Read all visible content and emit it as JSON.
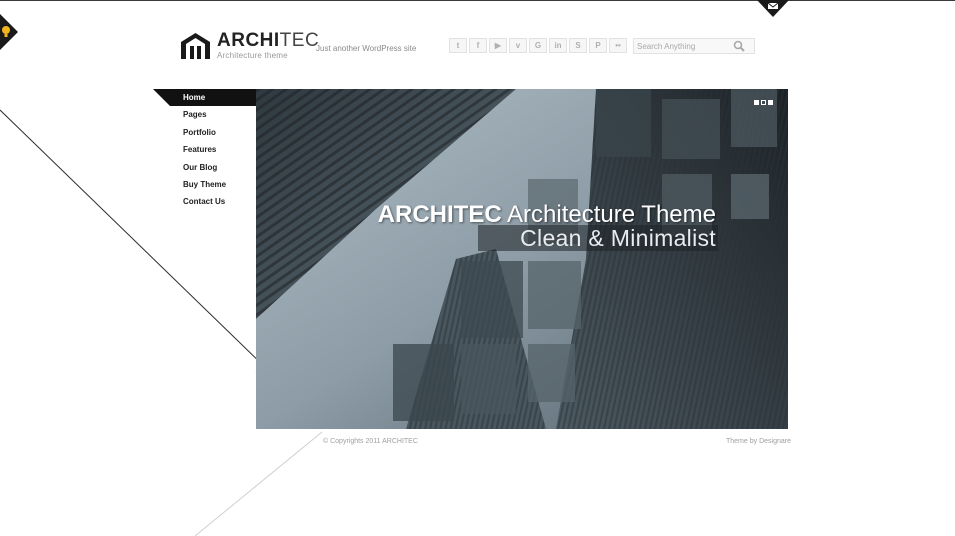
{
  "logo": {
    "title_bold": "ARCHI",
    "title_light": "TEC",
    "subtitle": "Architecture theme"
  },
  "tagline": "Just another WordPress site",
  "social": {
    "items": [
      {
        "icon": "twitter-icon",
        "glyph": "t"
      },
      {
        "icon": "facebook-icon",
        "glyph": "f"
      },
      {
        "icon": "youtube-icon",
        "glyph": "▶"
      },
      {
        "icon": "vimeo-icon",
        "glyph": "v"
      },
      {
        "icon": "google-icon",
        "glyph": "G"
      },
      {
        "icon": "linkedin-icon",
        "glyph": "in"
      },
      {
        "icon": "skype-icon",
        "glyph": "S"
      },
      {
        "icon": "pinterest-icon",
        "glyph": "P"
      },
      {
        "icon": "flickr-icon",
        "glyph": "••"
      }
    ]
  },
  "search": {
    "placeholder": "Search Anything"
  },
  "nav": {
    "items": [
      {
        "label": "Home"
      },
      {
        "label": "Pages"
      },
      {
        "label": "Portfolio"
      },
      {
        "label": "Features"
      },
      {
        "label": "Our Blog"
      },
      {
        "label": "Buy Theme"
      },
      {
        "label": "Contact Us"
      }
    ],
    "active_index": 0
  },
  "hero": {
    "title_bold": "ARCHITEC",
    "title_rest": " Architecture Theme",
    "subtitle": "Clean & Minimalist",
    "slide_dots": 3,
    "active_slide": 1
  },
  "footer": {
    "copyright": "© Copyrights 2011 ARCHITEC",
    "credit": "Theme by Designare"
  },
  "colors": {
    "accent": "#1a1a1a",
    "text": "#222222",
    "muted": "#a0a0a0"
  }
}
